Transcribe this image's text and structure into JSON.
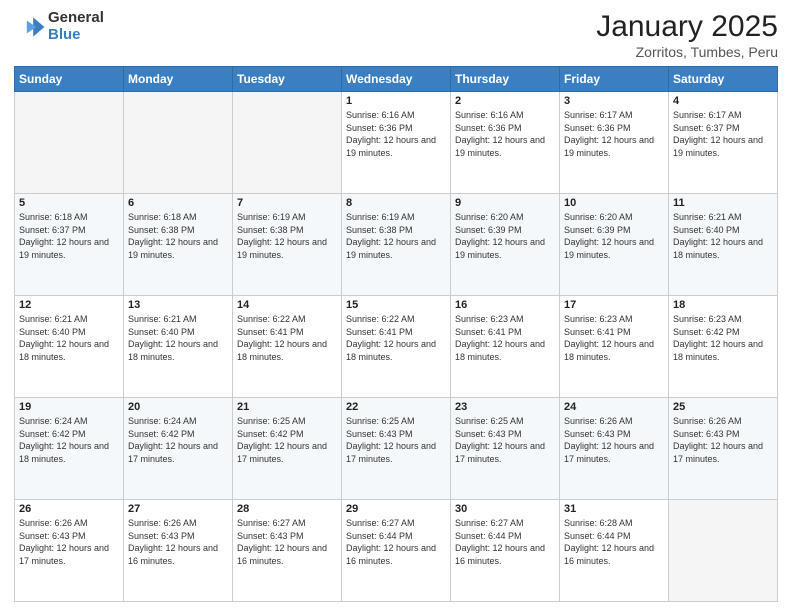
{
  "logo": {
    "general": "General",
    "blue": "Blue"
  },
  "header": {
    "month": "January 2025",
    "location": "Zorritos, Tumbes, Peru"
  },
  "weekdays": [
    "Sunday",
    "Monday",
    "Tuesday",
    "Wednesday",
    "Thursday",
    "Friday",
    "Saturday"
  ],
  "weeks": [
    [
      {
        "day": "",
        "info": ""
      },
      {
        "day": "",
        "info": ""
      },
      {
        "day": "",
        "info": ""
      },
      {
        "day": "1",
        "info": "Sunrise: 6:16 AM\nSunset: 6:36 PM\nDaylight: 12 hours and 19 minutes."
      },
      {
        "day": "2",
        "info": "Sunrise: 6:16 AM\nSunset: 6:36 PM\nDaylight: 12 hours and 19 minutes."
      },
      {
        "day": "3",
        "info": "Sunrise: 6:17 AM\nSunset: 6:36 PM\nDaylight: 12 hours and 19 minutes."
      },
      {
        "day": "4",
        "info": "Sunrise: 6:17 AM\nSunset: 6:37 PM\nDaylight: 12 hours and 19 minutes."
      }
    ],
    [
      {
        "day": "5",
        "info": "Sunrise: 6:18 AM\nSunset: 6:37 PM\nDaylight: 12 hours and 19 minutes."
      },
      {
        "day": "6",
        "info": "Sunrise: 6:18 AM\nSunset: 6:38 PM\nDaylight: 12 hours and 19 minutes."
      },
      {
        "day": "7",
        "info": "Sunrise: 6:19 AM\nSunset: 6:38 PM\nDaylight: 12 hours and 19 minutes."
      },
      {
        "day": "8",
        "info": "Sunrise: 6:19 AM\nSunset: 6:38 PM\nDaylight: 12 hours and 19 minutes."
      },
      {
        "day": "9",
        "info": "Sunrise: 6:20 AM\nSunset: 6:39 PM\nDaylight: 12 hours and 19 minutes."
      },
      {
        "day": "10",
        "info": "Sunrise: 6:20 AM\nSunset: 6:39 PM\nDaylight: 12 hours and 19 minutes."
      },
      {
        "day": "11",
        "info": "Sunrise: 6:21 AM\nSunset: 6:40 PM\nDaylight: 12 hours and 18 minutes."
      }
    ],
    [
      {
        "day": "12",
        "info": "Sunrise: 6:21 AM\nSunset: 6:40 PM\nDaylight: 12 hours and 18 minutes."
      },
      {
        "day": "13",
        "info": "Sunrise: 6:21 AM\nSunset: 6:40 PM\nDaylight: 12 hours and 18 minutes."
      },
      {
        "day": "14",
        "info": "Sunrise: 6:22 AM\nSunset: 6:41 PM\nDaylight: 12 hours and 18 minutes."
      },
      {
        "day": "15",
        "info": "Sunrise: 6:22 AM\nSunset: 6:41 PM\nDaylight: 12 hours and 18 minutes."
      },
      {
        "day": "16",
        "info": "Sunrise: 6:23 AM\nSunset: 6:41 PM\nDaylight: 12 hours and 18 minutes."
      },
      {
        "day": "17",
        "info": "Sunrise: 6:23 AM\nSunset: 6:41 PM\nDaylight: 12 hours and 18 minutes."
      },
      {
        "day": "18",
        "info": "Sunrise: 6:23 AM\nSunset: 6:42 PM\nDaylight: 12 hours and 18 minutes."
      }
    ],
    [
      {
        "day": "19",
        "info": "Sunrise: 6:24 AM\nSunset: 6:42 PM\nDaylight: 12 hours and 18 minutes."
      },
      {
        "day": "20",
        "info": "Sunrise: 6:24 AM\nSunset: 6:42 PM\nDaylight: 12 hours and 17 minutes."
      },
      {
        "day": "21",
        "info": "Sunrise: 6:25 AM\nSunset: 6:42 PM\nDaylight: 12 hours and 17 minutes."
      },
      {
        "day": "22",
        "info": "Sunrise: 6:25 AM\nSunset: 6:43 PM\nDaylight: 12 hours and 17 minutes."
      },
      {
        "day": "23",
        "info": "Sunrise: 6:25 AM\nSunset: 6:43 PM\nDaylight: 12 hours and 17 minutes."
      },
      {
        "day": "24",
        "info": "Sunrise: 6:26 AM\nSunset: 6:43 PM\nDaylight: 12 hours and 17 minutes."
      },
      {
        "day": "25",
        "info": "Sunrise: 6:26 AM\nSunset: 6:43 PM\nDaylight: 12 hours and 17 minutes."
      }
    ],
    [
      {
        "day": "26",
        "info": "Sunrise: 6:26 AM\nSunset: 6:43 PM\nDaylight: 12 hours and 17 minutes."
      },
      {
        "day": "27",
        "info": "Sunrise: 6:26 AM\nSunset: 6:43 PM\nDaylight: 12 hours and 16 minutes."
      },
      {
        "day": "28",
        "info": "Sunrise: 6:27 AM\nSunset: 6:43 PM\nDaylight: 12 hours and 16 minutes."
      },
      {
        "day": "29",
        "info": "Sunrise: 6:27 AM\nSunset: 6:44 PM\nDaylight: 12 hours and 16 minutes."
      },
      {
        "day": "30",
        "info": "Sunrise: 6:27 AM\nSunset: 6:44 PM\nDaylight: 12 hours and 16 minutes."
      },
      {
        "day": "31",
        "info": "Sunrise: 6:28 AM\nSunset: 6:44 PM\nDaylight: 12 hours and 16 minutes."
      },
      {
        "day": "",
        "info": ""
      }
    ]
  ]
}
